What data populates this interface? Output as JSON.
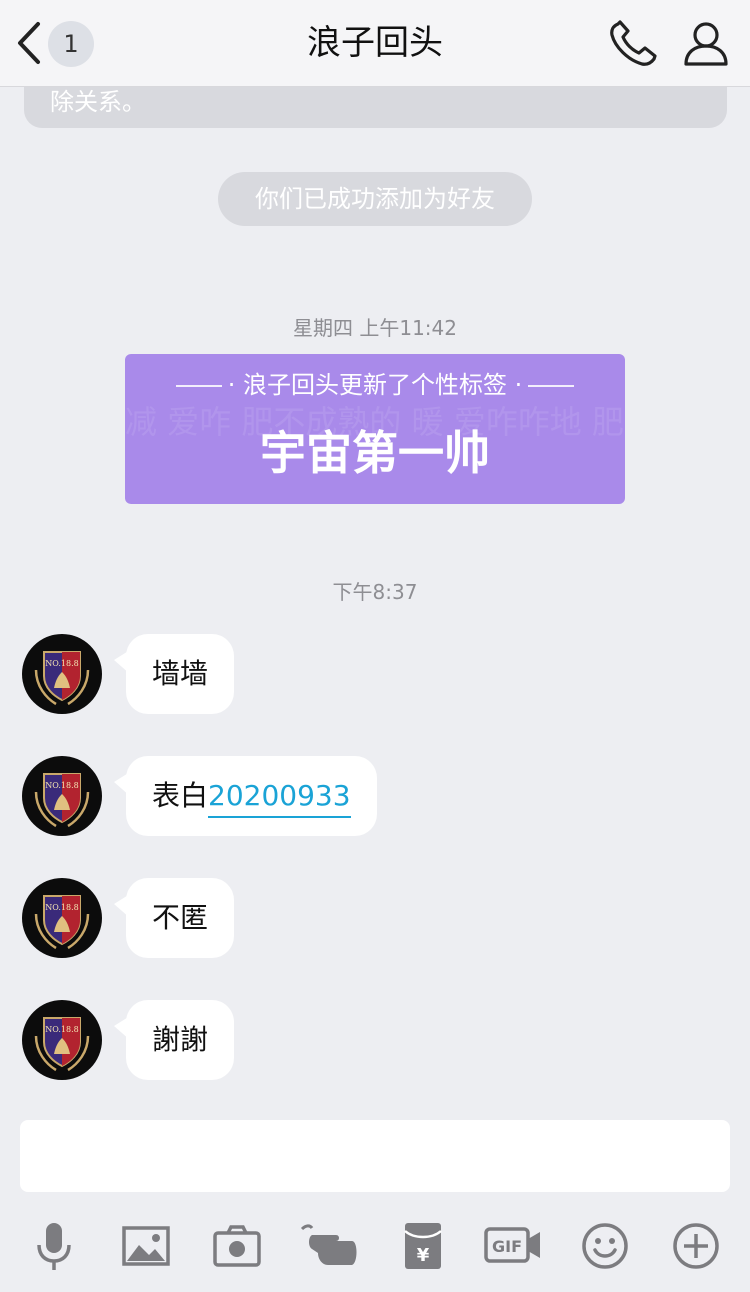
{
  "header": {
    "back_badge": "1",
    "title": "浪子回头"
  },
  "system": {
    "truncated_text": "除关系。",
    "friend_added": "你们已成功添加为好友",
    "timestamp_1": "星期四 上午11:42",
    "timestamp_2": "下午8:37"
  },
  "card": {
    "heading": "浪子回头更新了个性标签",
    "tag": "宇宙第一帅",
    "background_text": "减 爱咋 肥不成熟的 暖 爱咋咋地 肥嫌嫌嫌起来 能量 哦"
  },
  "messages": [
    {
      "text": "墙墙"
    },
    {
      "prefix": "表白",
      "link": "20200933"
    },
    {
      "text": "不匿"
    },
    {
      "text": "謝謝"
    }
  ],
  "colors": {
    "background": "#edeef2",
    "card_purple": "#a98aea",
    "link_blue": "#1aa3d6",
    "icon_gray": "#7c7c80"
  },
  "toolbar": {
    "icons": [
      "microphone-icon",
      "image-icon",
      "camera-icon",
      "poke-hand-icon",
      "red-packet-icon",
      "gif-icon",
      "emoji-icon",
      "plus-icon"
    ]
  }
}
